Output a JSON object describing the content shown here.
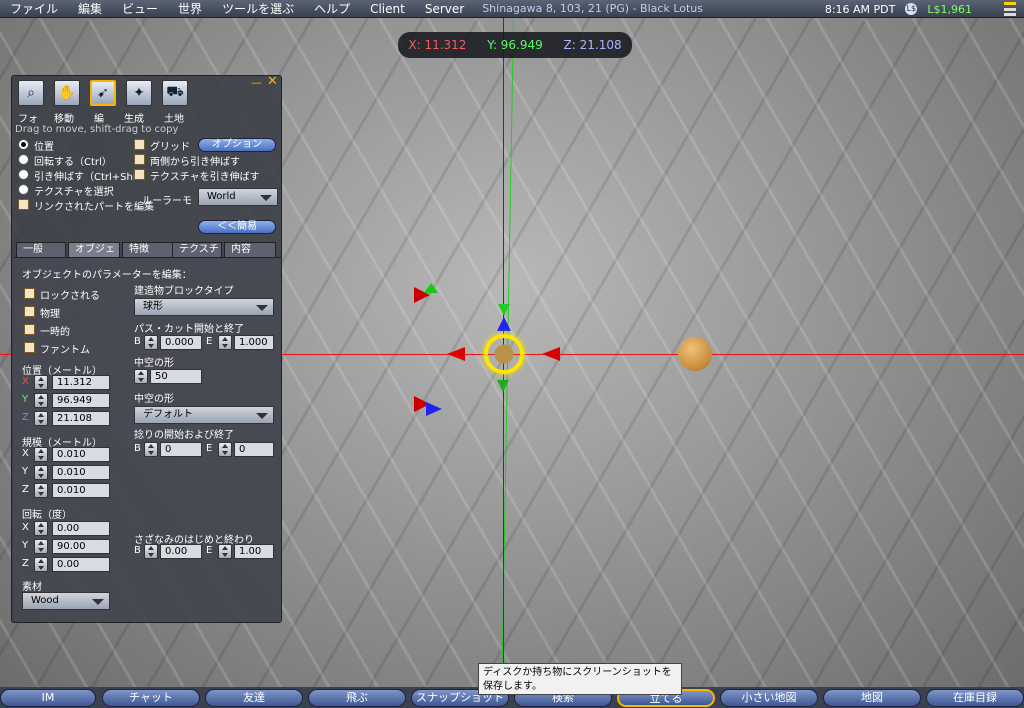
{
  "menubar": {
    "items": [
      "ファイル",
      "編集",
      "ビュー",
      "世界",
      "ツールを選ぶ",
      "ヘルプ",
      "Client",
      "Server"
    ],
    "region": "Shinagawa 8, 103, 21 (PG) - Black Lotus",
    "time": "8:16 AM PDT",
    "currency_symbol": "L$",
    "balance": "L$1,961"
  },
  "coords": {
    "x": "X: 11.312",
    "y": "Y: 96.949",
    "z": "Z: 21.108"
  },
  "build": {
    "tools": [
      {
        "label": "フォ",
        "icon": "focus-magnifier-icon"
      },
      {
        "label": "移動",
        "icon": "grab-hand-icon"
      },
      {
        "label": "編",
        "icon": "edit-pointer-icon"
      },
      {
        "label": "生成",
        "icon": "create-wand-icon"
      },
      {
        "label": "土地",
        "icon": "land-bulldozer-icon"
      }
    ],
    "hint": "Drag to move, shift-drag to copy",
    "radios": [
      "位置",
      "回転する（Ctrl）",
      "引き伸ばす（Ctrl+Shift）",
      "テクスチャを選択"
    ],
    "link_check": "リンクされたパートを編集",
    "grid_check": "グリッド",
    "options_button": "オプション",
    "stretch_both": "両側から引き伸ばす",
    "stretch_textures": "テクスチャを引き伸ばす",
    "ruler_label": "ルーラーモ",
    "ruler_value": "World",
    "less_button": "＜＜簡易",
    "tabs": [
      "一般",
      "オブジェクト",
      "特徴",
      "テクスチャ",
      "内容"
    ],
    "object": {
      "edit_title": "オブジェクトのパラメーターを編集：",
      "locked": "ロックされる",
      "physical": "物理",
      "temporary": "一時的",
      "phantom": "ファントム",
      "position_label": "位置（メートル）",
      "pos_x": "11.312",
      "pos_y": "96.949",
      "pos_z": "21.108",
      "size_label": "規模（メートル）",
      "size_x": "0.010",
      "size_y": "0.010",
      "size_z": "0.010",
      "rotation_label": "回転（度）",
      "rot_x": "0.00",
      "rot_y": "90.00",
      "rot_z": "0.00",
      "material_label": "素材",
      "material_value": "Wood",
      "building_block_label": "建造物ブロックタイプ",
      "building_block_value": "球形",
      "path_cut_label": "パス・カット開始と終了",
      "path_b": "0.000",
      "path_e": "1.000",
      "hollow_label": "中空の形",
      "hollow_value": "50",
      "hollow_shape_label": "中空の形",
      "hollow_shape_value": "デフォルト",
      "twist_label": "捻りの開始および終了",
      "twist_b": "0",
      "twist_e": "0",
      "dimple_label": "さざなみのはじめと終わり",
      "dimple_b": "0.00",
      "dimple_e": "1.00",
      "b": "B",
      "e": "E",
      "x": "X",
      "y": "Y",
      "z": "Z"
    }
  },
  "tooltip": "ディスクか持ち物にスクリーンショットを保存します。",
  "bottombar": [
    "IM",
    "チャット",
    "友達",
    "飛ぶ",
    "スナップショット",
    "検索",
    "立てる",
    "小さい地図",
    "地図",
    "在庫目録"
  ],
  "colors": {
    "accent": "#ffe600",
    "x_axis": "#e11111",
    "y_axis": "#22cc22",
    "z_axis": "#2222ee",
    "balance": "#7dff6a"
  }
}
